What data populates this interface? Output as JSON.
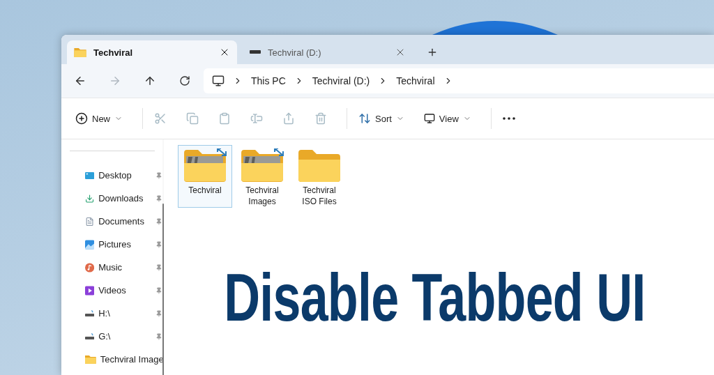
{
  "tabs": [
    {
      "label": "Techviral",
      "kind": "folder",
      "selected": true
    },
    {
      "label": "Techviral (D:)",
      "kind": "drive",
      "selected": false
    }
  ],
  "navigation": [
    {
      "kind": "back",
      "disabled": false
    },
    {
      "kind": "forward",
      "disabled": true
    },
    {
      "kind": "up",
      "disabled": false
    },
    {
      "kind": "refresh",
      "disabled": false
    }
  ],
  "breadcrumbs": [
    "This PC",
    "Techviral (D:)",
    "Techviral"
  ],
  "toolbar": [
    {
      "kind": "new",
      "label": "New",
      "disabled": false
    },
    {
      "kind": "cut",
      "disabled": true
    },
    {
      "kind": "copy",
      "disabled": true
    },
    {
      "kind": "paste",
      "disabled": true
    },
    {
      "kind": "rename",
      "disabled": true
    },
    {
      "kind": "share",
      "disabled": true
    },
    {
      "kind": "delete",
      "disabled": true
    },
    {
      "kind": "sort",
      "label": "Sort",
      "disabled": false
    },
    {
      "kind": "view",
      "label": "View",
      "disabled": false
    },
    {
      "kind": "more",
      "disabled": false
    }
  ],
  "sidebar": {
    "items": [
      {
        "label": "Desktop",
        "kind": "desktop",
        "pinned": true
      },
      {
        "label": "Downloads",
        "kind": "downloads",
        "pinned": true
      },
      {
        "label": "Documents",
        "kind": "documents",
        "pinned": true
      },
      {
        "label": "Pictures",
        "kind": "pictures",
        "pinned": true
      },
      {
        "label": "Music",
        "kind": "music",
        "pinned": true
      },
      {
        "label": "Videos",
        "kind": "videos",
        "pinned": true
      },
      {
        "label": "H:\\",
        "kind": "drive",
        "pinned": true
      },
      {
        "label": "G:\\",
        "kind": "drive",
        "pinned": true
      },
      {
        "label": "Techviral Image",
        "kind": "folder",
        "pinned": false
      }
    ]
  },
  "files": [
    {
      "name": "Techviral",
      "kind": "shared",
      "selected": true
    },
    {
      "name": "Techviral Images",
      "kind": "shared",
      "selected": false
    },
    {
      "name": "Techviral ISO Files",
      "kind": "plain",
      "selected": false
    }
  ],
  "headline": "Disable Tabbed UI"
}
